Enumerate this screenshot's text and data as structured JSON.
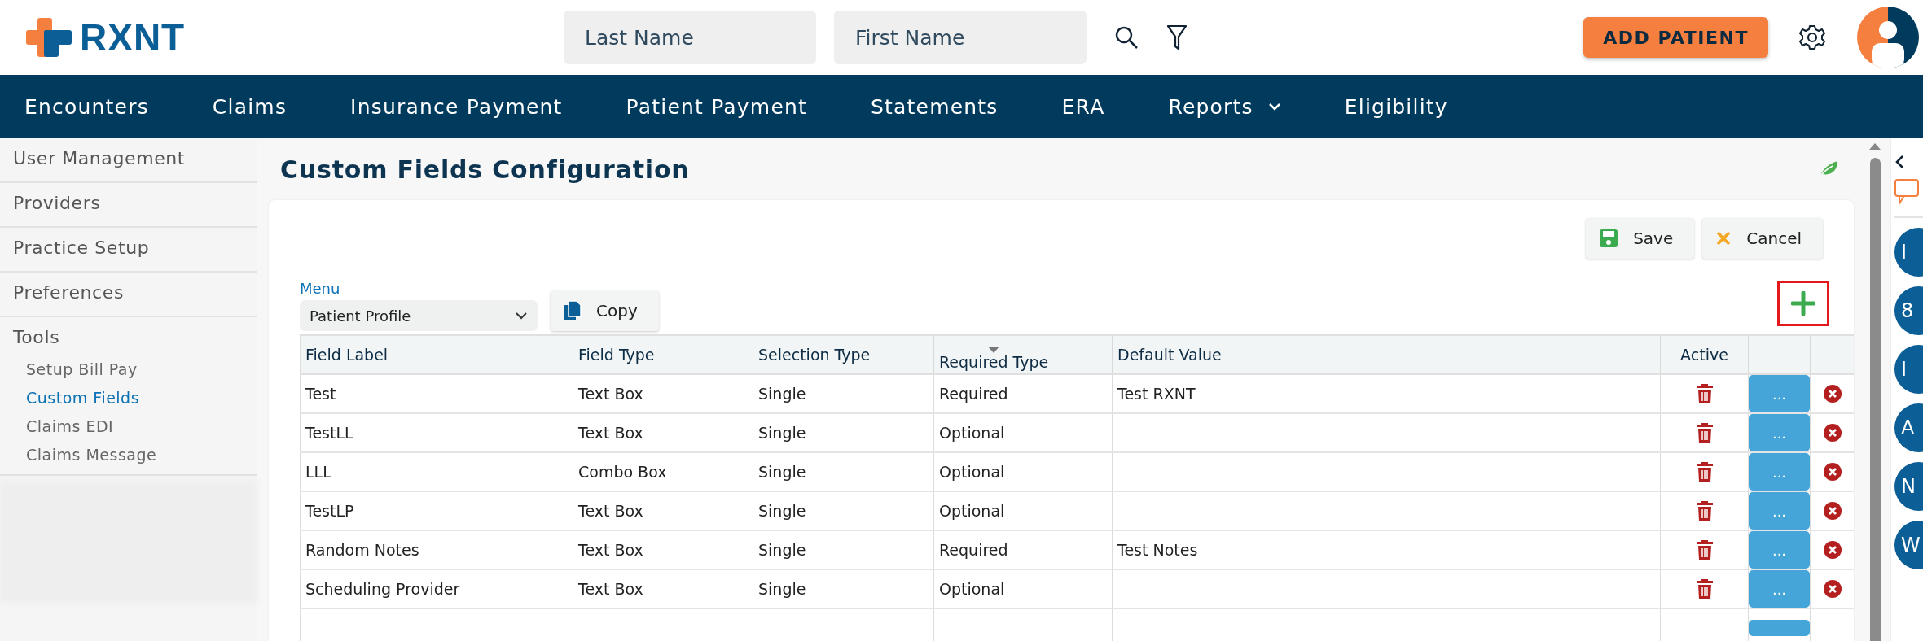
{
  "header": {
    "logo_text": "RXNT",
    "last_name": {
      "placeholder": "Last Name"
    },
    "first_name": {
      "placeholder": "First Name"
    },
    "add_button": "ADD PATIENT"
  },
  "nav": [
    {
      "label": "Encounters",
      "has_menu": false
    },
    {
      "label": "Claims",
      "has_menu": false
    },
    {
      "label": "Insurance Payment",
      "has_menu": false
    },
    {
      "label": "Patient Payment",
      "has_menu": false
    },
    {
      "label": "Statements",
      "has_menu": false
    },
    {
      "label": "ERA",
      "has_menu": false
    },
    {
      "label": "Reports",
      "has_menu": true
    },
    {
      "label": "Eligibility",
      "has_menu": false
    }
  ],
  "sidebar": {
    "items": [
      {
        "label": "User Management",
        "selected": false
      },
      {
        "label": "Providers",
        "selected": false
      },
      {
        "label": "Practice Setup",
        "selected": false
      },
      {
        "label": "Preferences",
        "selected": false
      },
      {
        "label": "Tools",
        "selected": false,
        "children": [
          {
            "label": "Setup Bill Pay",
            "selected": false
          },
          {
            "label": "Custom Fields",
            "selected": true
          },
          {
            "label": "Claims EDI",
            "selected": false
          },
          {
            "label": "Claims Message",
            "selected": false
          }
        ]
      }
    ]
  },
  "page": {
    "title": "Custom Fields Configuration",
    "save": "Save",
    "cancel": "Cancel",
    "menu_label": "Menu",
    "menu_value": "Patient Profile",
    "copy": "Copy"
  },
  "table": {
    "columns": [
      {
        "label": "Field Label",
        "sorted": false
      },
      {
        "label": "Field Type",
        "sorted": false
      },
      {
        "label": "Selection Type",
        "sorted": false
      },
      {
        "label": "Required Type",
        "sorted": true
      },
      {
        "label": "Default Value",
        "sorted": false
      },
      {
        "label": "Active",
        "sorted": false
      }
    ],
    "rows": [
      {
        "cells": [
          "Test",
          "Text Box",
          "Single",
          "Required",
          "Test RXNT"
        ],
        "action_label": "..."
      },
      {
        "cells": [
          "TestLL",
          "Text Box",
          "Single",
          "Optional",
          ""
        ],
        "action_label": "..."
      },
      {
        "cells": [
          "LLL",
          "Combo Box",
          "Single",
          "Optional",
          ""
        ],
        "action_label": "..."
      },
      {
        "cells": [
          "TestLP",
          "Text Box",
          "Single",
          "Optional",
          ""
        ],
        "action_label": "..."
      },
      {
        "cells": [
          "Random Notes",
          "Text Box",
          "Single",
          "Required",
          "Test Notes"
        ],
        "action_label": "..."
      },
      {
        "cells": [
          "Scheduling Provider",
          "Text Box",
          "Single",
          "Optional",
          ""
        ],
        "action_label": "..."
      }
    ]
  },
  "right_rail": {
    "badges": [
      "I",
      "8",
      "I",
      "A",
      "N",
      "W"
    ]
  }
}
